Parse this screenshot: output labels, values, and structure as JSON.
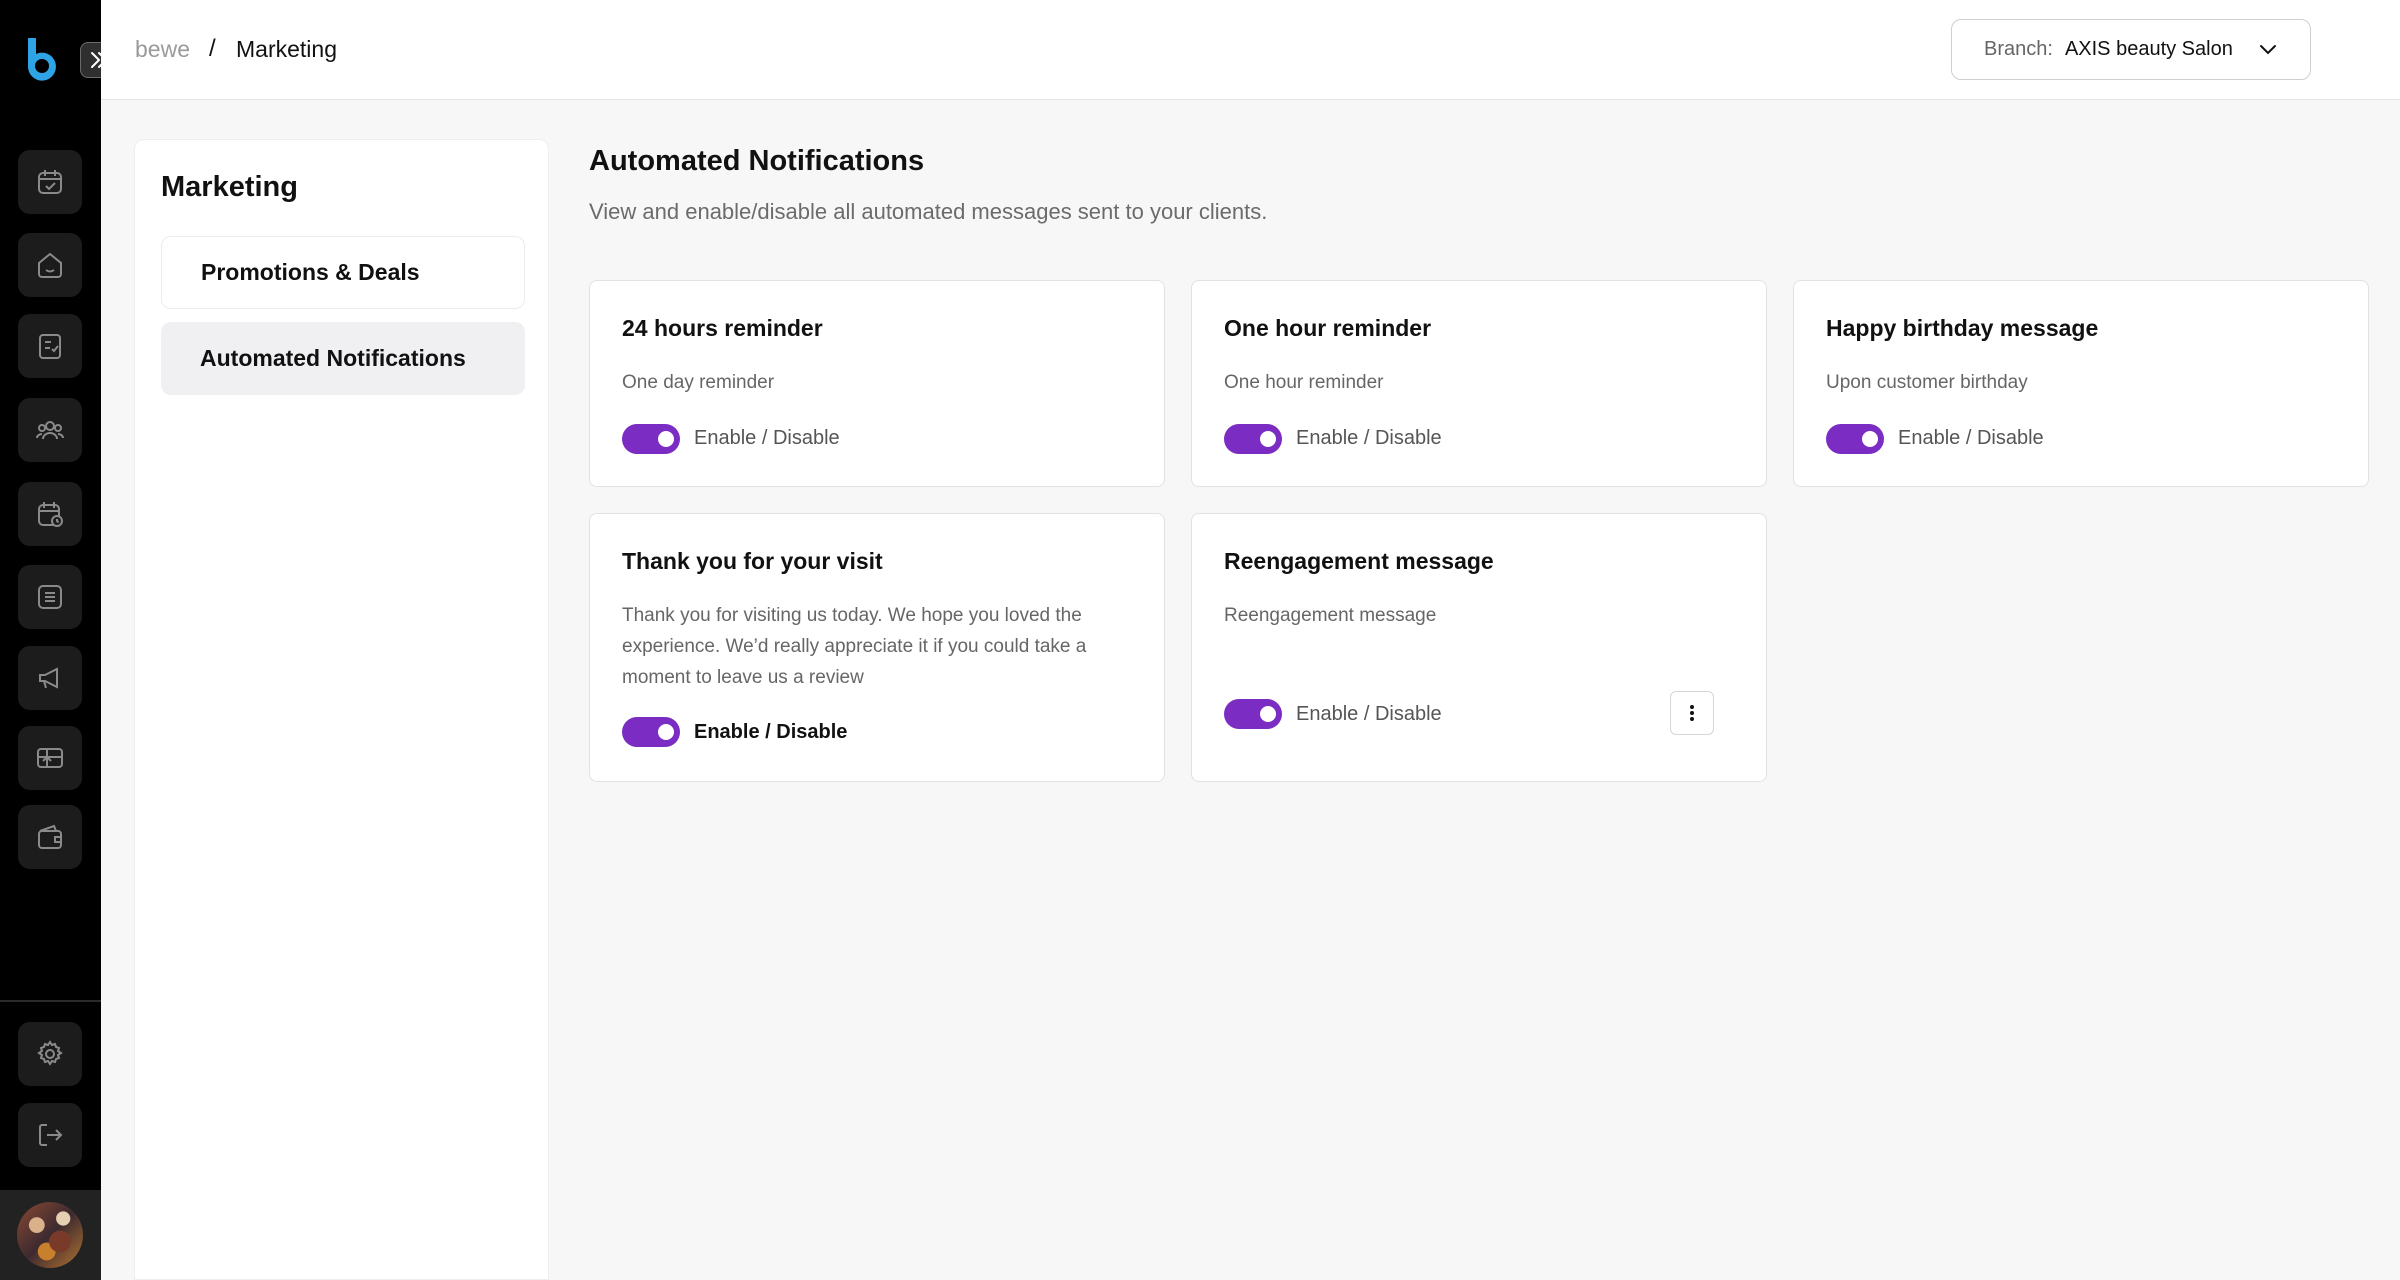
{
  "app": {
    "logo_letter": "b",
    "rail_icons": [
      "calendar-check-icon",
      "home-icon",
      "clipboard-icon",
      "users-icon",
      "calendar-clock-icon",
      "list-icon",
      "megaphone-icon",
      "gift-card-icon",
      "wallet-icon"
    ],
    "rail_bottom_icons": [
      "gear-icon",
      "logout-icon"
    ],
    "accent_color": "#7b2cc2"
  },
  "header": {
    "breadcrumb_root": "bewe",
    "breadcrumb_separator": "/",
    "breadcrumb_current": "Marketing",
    "branch_label": "Branch:",
    "branch_value": "AXIS beauty Salon"
  },
  "sidebar": {
    "title": "Marketing",
    "items": [
      {
        "label": "Promotions & Deals",
        "active": false
      },
      {
        "label": "Automated Notifications",
        "active": true
      }
    ]
  },
  "main": {
    "title": "Automated Notifications",
    "description": "View and enable/disable all automated messages sent to your clients.",
    "cards": [
      {
        "title": "24 hours reminder",
        "subtitle": "One day reminder",
        "toggle_label": "Enable / Disable",
        "enabled": true
      },
      {
        "title": "One hour reminder",
        "subtitle": "One hour reminder",
        "toggle_label": "Enable / Disable",
        "enabled": true
      },
      {
        "title": "Happy birthday message",
        "subtitle": "Upon customer birthday",
        "toggle_label": "Enable / Disable",
        "enabled": true
      },
      {
        "title": "Thank you for your visit",
        "subtitle": "Thank you for visiting us today. We hope you loved the experience. We’d really appreciate it if you could take a moment to leave us a review",
        "toggle_label": "Enable / Disable",
        "enabled": true
      },
      {
        "title": "Reengagement message",
        "subtitle": "Reengagement message",
        "toggle_label": "Enable / Disable",
        "enabled": true
      }
    ]
  }
}
